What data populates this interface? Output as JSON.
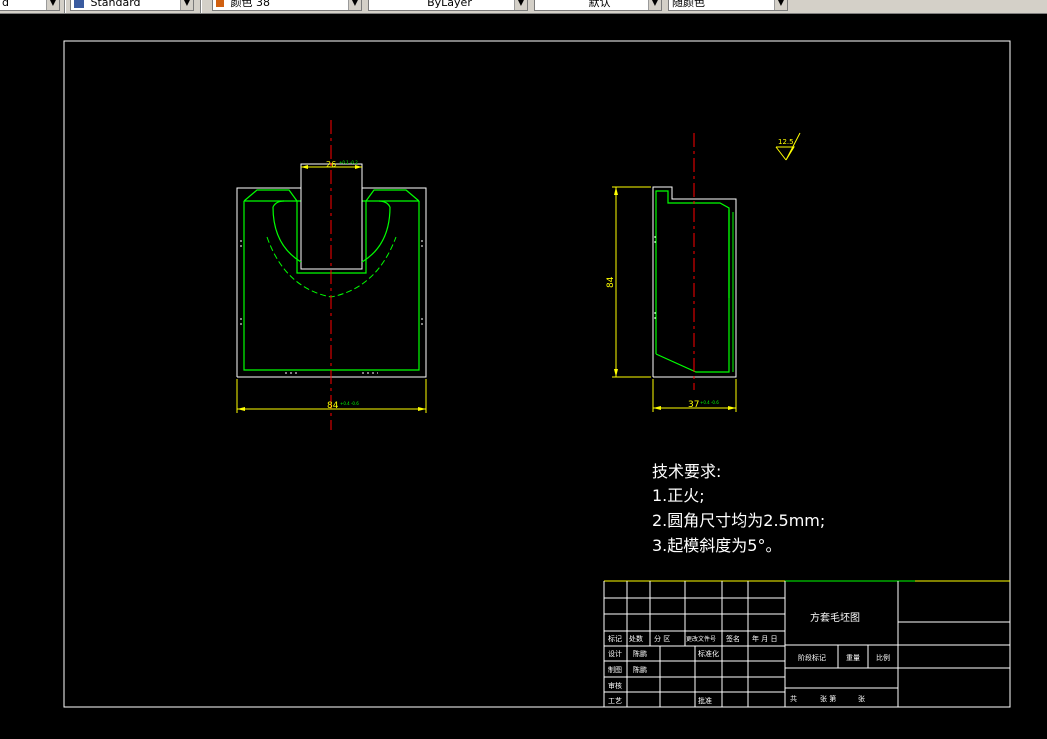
{
  "toolbar": {
    "combo0": "d",
    "text_style": "Standard",
    "color": "颜色 38",
    "linetype": "ByLayer",
    "lineweight": "默认",
    "plot_style": "随颜色"
  },
  "drawing": {
    "front_top_dim": "26",
    "front_top_tol": "+0.1 -0.2",
    "front_bottom_dim": "84",
    "front_bottom_tol": "+0.4 -0.6",
    "side_height_dim": "84",
    "side_bottom_dim": "37",
    "side_bottom_tol": "+0.4 -0.6",
    "roughness": "12.5"
  },
  "requirements": {
    "heading": "技术要求:",
    "item1": "1.正火;",
    "item2": "2.圆角尺寸均为2.5mm;",
    "item3": "3.起模斜度为5°。"
  },
  "title_block": {
    "drawing_title": "方套毛坯图",
    "biaoji": "标记",
    "chushu": "处数",
    "fenqu": "分 区",
    "gengwen": "更改文件号",
    "qianming": "签名",
    "nianyueri": "年 月 日",
    "sheji": "设计",
    "designer": "陈鹏",
    "biaozhunhua": "标准化",
    "zhitu": "制图",
    "drafter": "陈鹏",
    "shenhe": "审核",
    "gongyi": "工艺",
    "pizhun": "批准",
    "jieduan": "阶段标记",
    "zhongliang": "重量",
    "bili": "比例",
    "gong": "共",
    "zhang": "张 第",
    "zhang2": "张"
  }
}
